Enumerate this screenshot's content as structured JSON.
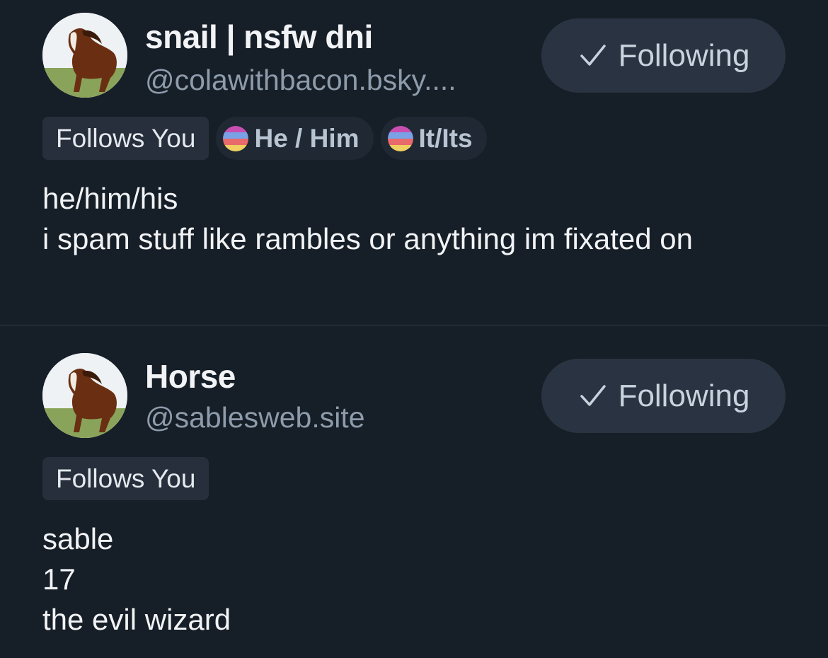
{
  "users": [
    {
      "display_name": "snail | nsfw dni",
      "handle": "@colawithbacon.bsky....",
      "follow_button": "Following",
      "follows_you": "Follows You",
      "pronoun_badges": [
        "He / Him",
        "It/Its"
      ],
      "bio_lines": [
        "he/him/his",
        "i spam stuff like rambles or anything im fixated on"
      ]
    },
    {
      "display_name": "Horse",
      "handle": "@sablesweb.site",
      "follow_button": "Following",
      "follows_you": "Follows You",
      "bio_lines": [
        "sable",
        "17",
        "the evil wizard"
      ]
    }
  ],
  "icons": {
    "follow_check": "checkmark-icon",
    "pronoun_flag": "pronoun-flag-icon",
    "avatar": "horse-avatar"
  },
  "colors": {
    "background": "#161e27",
    "button_bg": "#2a3341",
    "badge_bg": "#262f3b",
    "handle_text": "#8d9bab"
  }
}
